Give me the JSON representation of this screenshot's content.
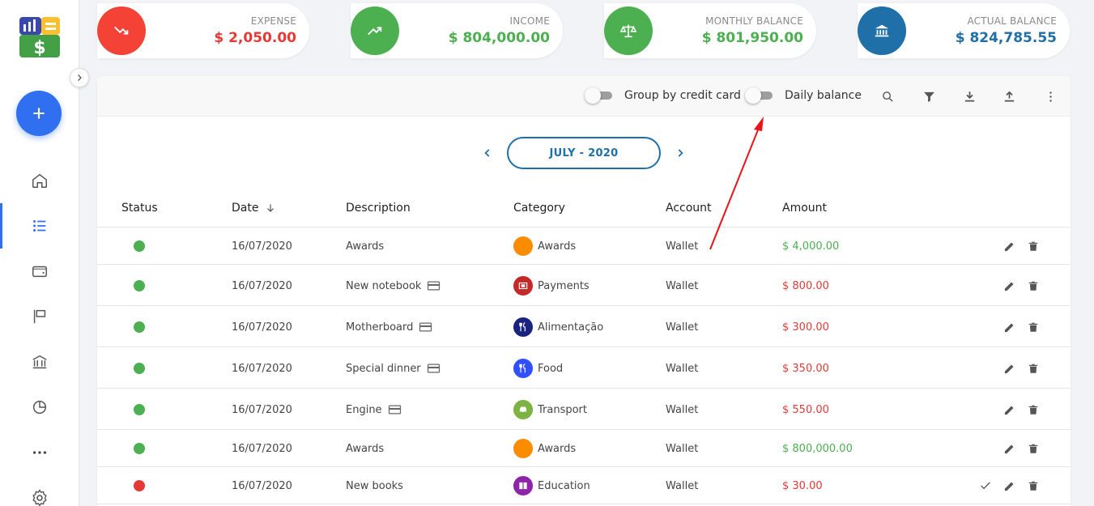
{
  "summary": {
    "expense": {
      "label": "EXPENSE",
      "value": "$ 2,050.00",
      "color": "#e53935",
      "icon": "trending-down-icon"
    },
    "income": {
      "label": "INCOME",
      "value": "$ 804,000.00",
      "color": "#4caf50",
      "icon": "trending-up-icon"
    },
    "monthly_balance": {
      "label": "MONTHLY BALANCE",
      "value": "$ 801,950.00",
      "color": "#4caf50",
      "icon": "scale-icon"
    },
    "actual_balance": {
      "label": "ACTUAL BALANCE",
      "value": "$ 824,785.55",
      "color": "#1f6fa8",
      "icon": "bank-icon"
    }
  },
  "toolbar": {
    "group_by_credit_card": "Group by credit card",
    "daily_balance": "Daily balance"
  },
  "month": {
    "label": "JULY - 2020"
  },
  "table": {
    "headers": {
      "status": "Status",
      "date": "Date",
      "description": "Description",
      "category": "Category",
      "account": "Account",
      "amount": "Amount"
    },
    "rows": [
      {
        "status": "paid",
        "date": "16/07/2020",
        "description": "Awards",
        "credit_card": false,
        "category": "Awards",
        "category_color": "#fb8c00",
        "account": "Wallet",
        "amount": "$ 4,000.00",
        "type": "income"
      },
      {
        "status": "paid",
        "date": "16/07/2020",
        "description": "New notebook",
        "credit_card": true,
        "category": "Payments",
        "category_color": "#c62828",
        "account": "Wallet",
        "amount": "$ 800.00",
        "type": "expense"
      },
      {
        "status": "paid",
        "date": "16/07/2020",
        "description": "Motherboard",
        "credit_card": true,
        "category": "Alimentação",
        "category_color": "#1a237e",
        "account": "Wallet",
        "amount": "$ 300.00",
        "type": "expense"
      },
      {
        "status": "paid",
        "date": "16/07/2020",
        "description": "Special dinner",
        "credit_card": true,
        "category": "Food",
        "category_color": "#304ffe",
        "account": "Wallet",
        "amount": "$ 350.00",
        "type": "expense"
      },
      {
        "status": "paid",
        "date": "16/07/2020",
        "description": "Engine",
        "credit_card": true,
        "category": "Transport",
        "category_color": "#7cb342",
        "account": "Wallet",
        "amount": "$ 550.00",
        "type": "expense"
      },
      {
        "status": "paid",
        "date": "16/07/2020",
        "description": "Awards",
        "credit_card": false,
        "category": "Awards",
        "category_color": "#fb8c00",
        "account": "Wallet",
        "amount": "$ 800,000.00",
        "type": "income"
      },
      {
        "status": "unpaid",
        "date": "16/07/2020",
        "description": "New books",
        "credit_card": false,
        "category": "Education",
        "category_color": "#8e24aa",
        "account": "Wallet",
        "amount": "$ 30.00",
        "type": "expense"
      }
    ]
  },
  "colors": {
    "primary": "#2f6ff0",
    "income": "#4caf50",
    "expense": "#e53935",
    "accent": "#1f6fa8",
    "status_paid": "#4caf50",
    "status_unpaid": "#e53935"
  }
}
